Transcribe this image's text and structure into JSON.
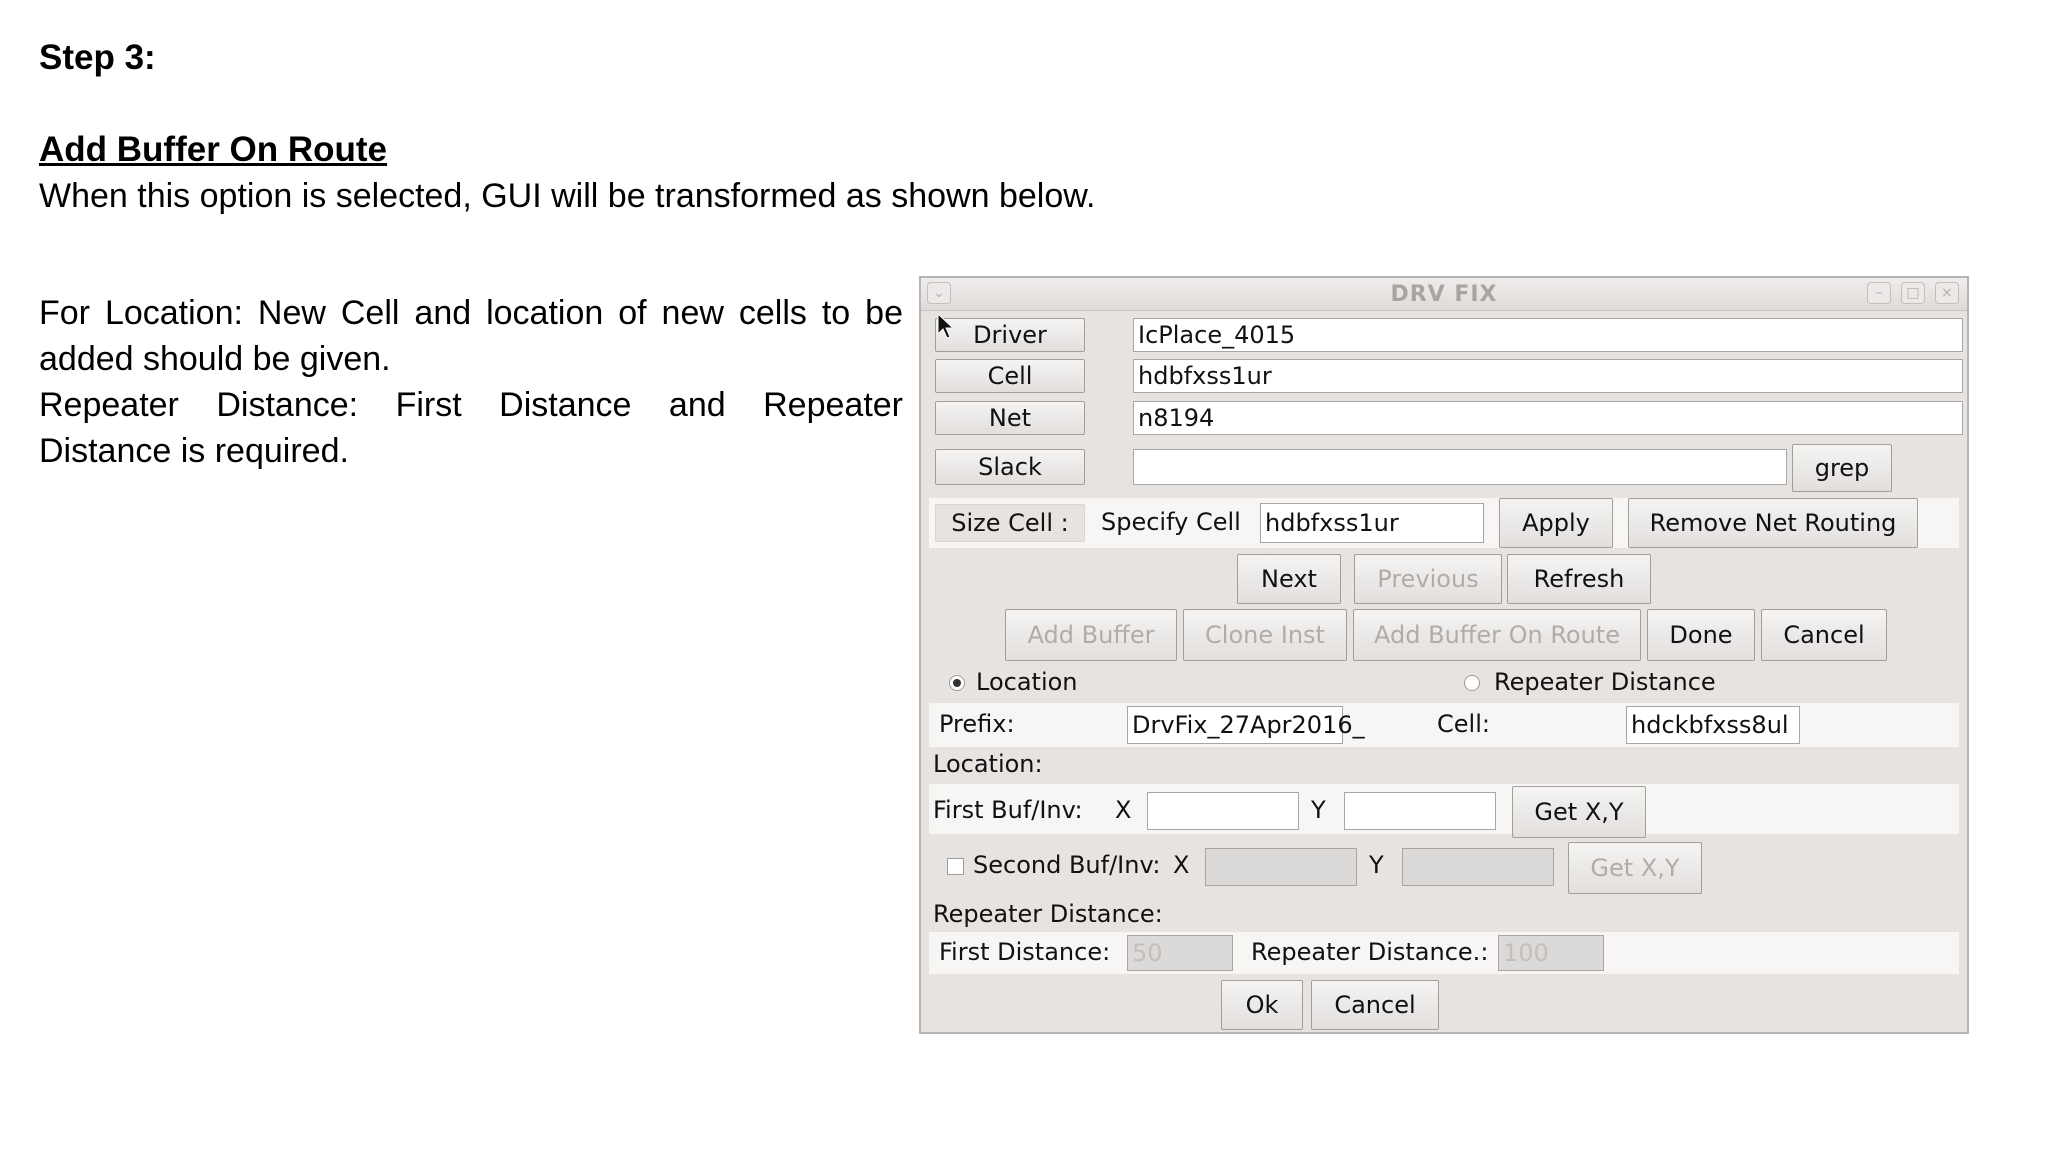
{
  "doc": {
    "step": "Step 3:",
    "heading": "Add Buffer On Route",
    "description": "When this option is selected, GUI will be transformed as shown below.",
    "location_note": "For Location: New Cell and location of new cells to be added should be given.",
    "repeater_note": "Repeater Distance: First Distance and Repeater Distance is required."
  },
  "dialog": {
    "title": "DRV FIX",
    "driver_button": "Driver",
    "driver_value": "IcPlace_4015",
    "cell_button": "Cell",
    "cell_value": "hdbfxss1ur",
    "net_button": "Net",
    "net_value": "n8194",
    "slack_button": "Slack",
    "slack_value": "",
    "grep_button": "grep",
    "size_cell_button": "Size Cell :",
    "specify_cell_label": "Specify Cell",
    "specify_cell_value": "hdbfxss1ur",
    "apply_button": "Apply",
    "remove_net_routing_button": "Remove Net Routing",
    "next_button": "Next",
    "previous_button": "Previous",
    "refresh_button": "Refresh",
    "add_buffer_button": "Add Buffer",
    "clone_inst_button": "Clone Inst",
    "add_buffer_on_route_button": "Add Buffer On Route",
    "done_button": "Done",
    "cancel_button": "Cancel",
    "radio_location": "Location",
    "radio_repeater": "Repeater Distance",
    "prefix_label": "Prefix:",
    "prefix_value": "DrvFix_27Apr2016_",
    "cell_label": "Cell:",
    "cell_field_value": "hdckbfxss8ul",
    "location_section": "Location:",
    "first_buf_label": "First Buf/Inv:",
    "x_label": "X",
    "y_label": "Y",
    "get_xy_button": "Get X,Y",
    "second_buf_label": "Second Buf/Inv:",
    "repeater_section": "Repeater Distance:",
    "first_distance_label": "First Distance:",
    "first_distance_value": "50",
    "repeater_distance_label": "Repeater Distance.:",
    "repeater_distance_value": "100",
    "ok_button": "Ok",
    "cancel_bottom_button": "Cancel"
  }
}
